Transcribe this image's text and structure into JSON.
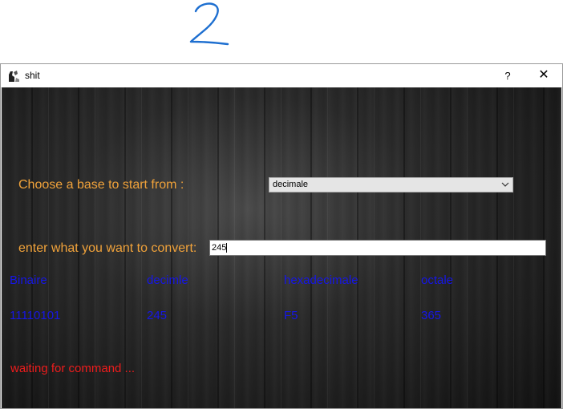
{
  "annotation": {
    "text": "2",
    "color": "#1e6fd0"
  },
  "window": {
    "title": "shit",
    "help_label": "?",
    "close_label": "✕"
  },
  "form": {
    "base_label": "Choose a base to start from :",
    "base_select_value": "decimale",
    "input_label": "enter what you want to convert:",
    "input_value": "245"
  },
  "results": {
    "headers": [
      "Binaire",
      "decimle",
      "hexadecimale",
      "octale"
    ],
    "values": [
      "11110101",
      "245",
      "F5",
      "365"
    ]
  },
  "status": {
    "text": "waiting for command ..."
  },
  "colors": {
    "label": "#f0a23a",
    "result_text": "#1616e6",
    "status_text": "#ee1c1c",
    "background": "#1c1c1c"
  }
}
